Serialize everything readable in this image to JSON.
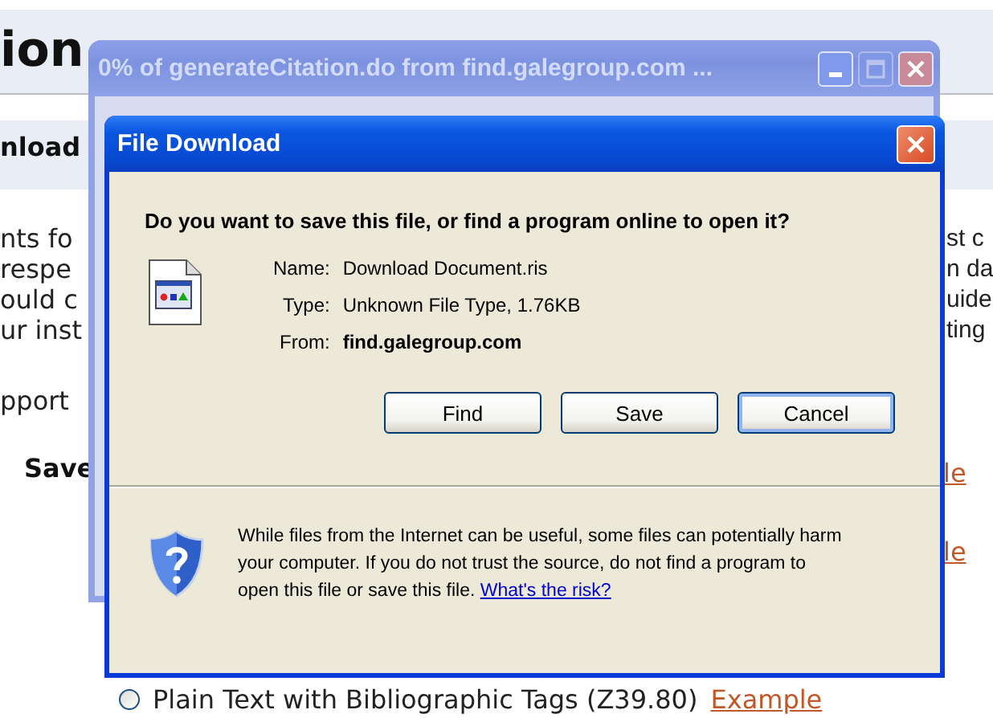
{
  "page": {
    "heading": "ion",
    "band_label": "nload",
    "left_lines": [
      "nts fo",
      "respe",
      "ould c",
      "ur inst"
    ],
    "right_lines": [
      "st c",
      "n da",
      "uide",
      "ting"
    ],
    "support": "pport",
    "save": "Save",
    "side_links": [
      "le",
      "le"
    ],
    "option": {
      "label": "Plain Text with Bibliographic Tags (Z39.80)",
      "selected": false,
      "link": "Example"
    }
  },
  "progress_window": {
    "title": "0% of generateCitation.do from find.galegroup.com ...",
    "controls": [
      {
        "kind": "minimize",
        "disabled": false
      },
      {
        "kind": "maximize",
        "disabled": true
      },
      {
        "kind": "close",
        "disabled": false
      }
    ]
  },
  "dialog": {
    "title": "File Download",
    "question": "Do you want to save this file, or find a program online to open it?",
    "fields": [
      {
        "label": "Name:",
        "value": "Download Document.ris",
        "bold": false
      },
      {
        "label": "Type:",
        "value": "Unknown File Type, 1.76KB",
        "bold": false
      },
      {
        "label": "From:",
        "value": "find.galegroup.com",
        "bold": true
      }
    ],
    "buttons": [
      {
        "label": "Find",
        "default": false
      },
      {
        "label": "Save",
        "default": false
      },
      {
        "label": "Cancel",
        "default": true
      }
    ],
    "warning": "While files from the Internet can be useful, some files can potentially harm your computer. If you do not trust the source, do not find a program to open this file or save this file.",
    "risk_link": "What's the risk?"
  }
}
